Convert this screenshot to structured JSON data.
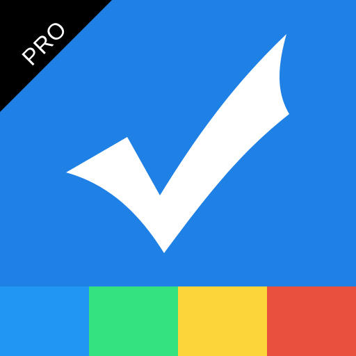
{
  "badge": {
    "label": "PRO"
  },
  "icon": {
    "symbol": "checkmark-icon"
  },
  "colors": {
    "main_blue": "#1F80E6",
    "ribbon_black": "#000000",
    "check_white": "#FFFFFF",
    "strip_blue": "#2196F3",
    "strip_green": "#34E37F",
    "strip_yellow": "#FBD53A",
    "strip_red": "#E9503D"
  },
  "color_strip": [
    {
      "name": "blue",
      "color": "#2196F3"
    },
    {
      "name": "green",
      "color": "#34E37F"
    },
    {
      "name": "yellow",
      "color": "#FBD53A"
    },
    {
      "name": "red",
      "color": "#E9503D"
    }
  ]
}
